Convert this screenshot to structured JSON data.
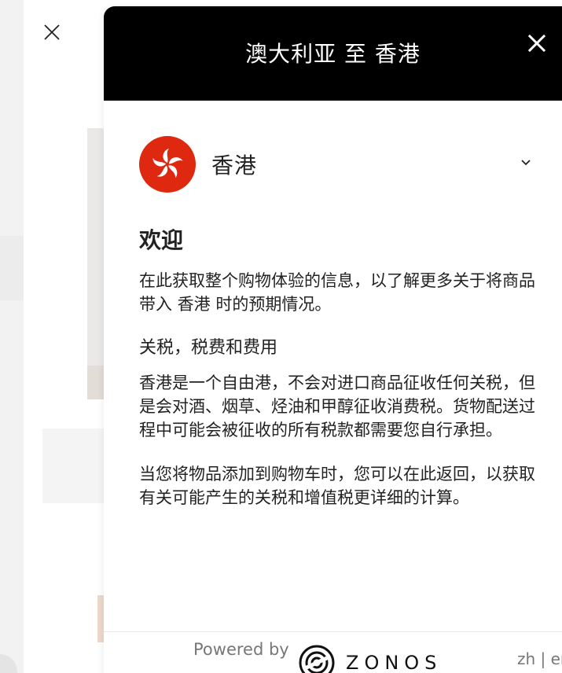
{
  "modal": {
    "title": "澳大利亚 至 香港",
    "country": "香港",
    "welcome_title": "欢迎",
    "welcome_text": "在此获取整个购物体验的信息，以了解更多关于将商品带入 香港 时的预期情况。",
    "duties_title": "关税，税费和费用",
    "duties_text": "香港是一个自由港，不会对进口商品征收任何关税，但是会对酒、烟草、烃油和甲醇征收消费税。货物配送过程中可能会被征收的所有税款都需要您自行承担。",
    "return_text": "当您将物品添加到购物车时，您可以在此返回，以获取有关可能产生的关税和增值税更详细的计算。"
  },
  "footer": {
    "powered_by": "Powered by",
    "brand": "ZONOS",
    "language": "zh | en"
  },
  "icons": {
    "background_close": "close-icon",
    "modal_close": "close-icon",
    "flag": "hong-kong-flag-icon",
    "dropdown": "chevron-down-icon",
    "brand_logo": "zonos-logo-icon"
  },
  "colors": {
    "header_bg": "#000000",
    "flag_red": "#de2910",
    "text": "#222222",
    "muted": "#777777"
  }
}
